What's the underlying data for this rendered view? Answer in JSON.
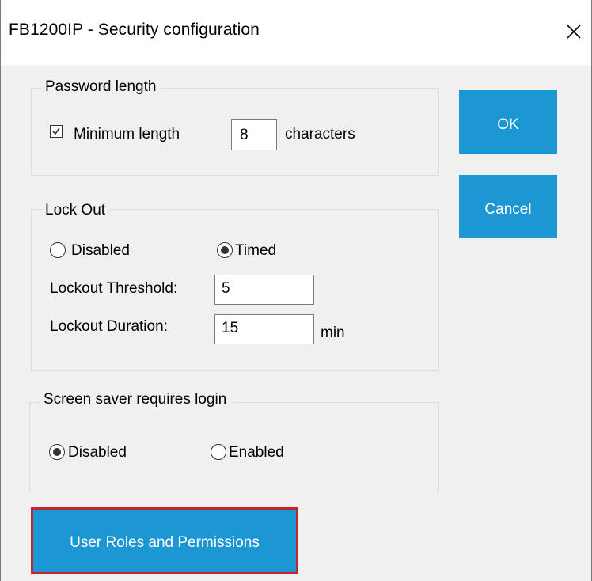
{
  "window": {
    "title": "FB1200IP - Security configuration"
  },
  "password_length": {
    "legend": "Password length",
    "minimum_length_label": "Minimum length",
    "minimum_length_checked": true,
    "minimum_length_value": "8",
    "units_label": "characters"
  },
  "lock_out": {
    "legend": "Lock Out",
    "options": [
      "Disabled",
      "Timed"
    ],
    "selected": "Timed",
    "threshold_label": "Lockout Threshold:",
    "threshold_value": "5",
    "duration_label": "Lockout Duration:",
    "duration_value": "15",
    "duration_units": "min"
  },
  "screen_saver": {
    "legend": "Screen saver requires login",
    "options": [
      "Disabled",
      "Enabled"
    ],
    "selected": "Disabled"
  },
  "buttons": {
    "ok": "OK",
    "cancel": "Cancel",
    "user_roles": "User Roles and Permissions"
  },
  "colors": {
    "button_blue": "#1c97d3",
    "focus_outline": "#c0272d"
  }
}
